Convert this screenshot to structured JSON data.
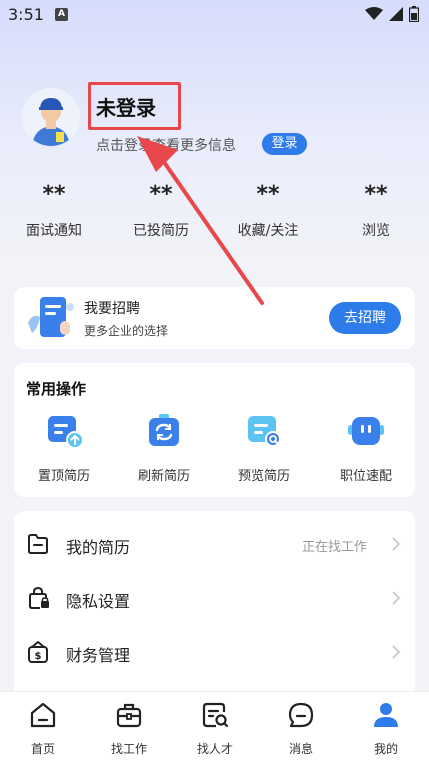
{
  "status_bar": {
    "time": "3:51",
    "notif_letter": "A"
  },
  "profile": {
    "name": "未登录",
    "subtitle": "点击登录查看更多信息",
    "login_label": "登录"
  },
  "stats": [
    {
      "value": "**",
      "label": "面试通知"
    },
    {
      "value": "**",
      "label": "已投简历"
    },
    {
      "value": "**",
      "label": "收藏/关注"
    },
    {
      "value": "**",
      "label": "浏览"
    }
  ],
  "recruit": {
    "title": "我要招聘",
    "subtitle": "更多企业的选择",
    "button": "去招聘"
  },
  "ops": {
    "title": "常用操作",
    "items": [
      {
        "label": "置顶简历",
        "icon": "pin-resume-icon"
      },
      {
        "label": "刷新简历",
        "icon": "refresh-resume-icon"
      },
      {
        "label": "预览简历",
        "icon": "preview-resume-icon"
      },
      {
        "label": "职位速配",
        "icon": "robot-match-icon"
      }
    ]
  },
  "menu": [
    {
      "label": "我的简历",
      "value": "正在找工作",
      "icon": "folder-icon"
    },
    {
      "label": "隐私设置",
      "value": "",
      "icon": "lock-icon"
    },
    {
      "label": "财务管理",
      "value": "",
      "icon": "wallet-icon"
    }
  ],
  "nav": [
    {
      "label": "首页",
      "icon": "home-icon",
      "active": false
    },
    {
      "label": "找工作",
      "icon": "briefcase-icon",
      "active": false
    },
    {
      "label": "找人才",
      "icon": "talent-search-icon",
      "active": false
    },
    {
      "label": "消息",
      "icon": "message-icon",
      "active": false
    },
    {
      "label": "我的",
      "icon": "user-icon",
      "active": true
    }
  ],
  "colors": {
    "accent": "#2e7bea",
    "highlight": "#e8474c"
  }
}
